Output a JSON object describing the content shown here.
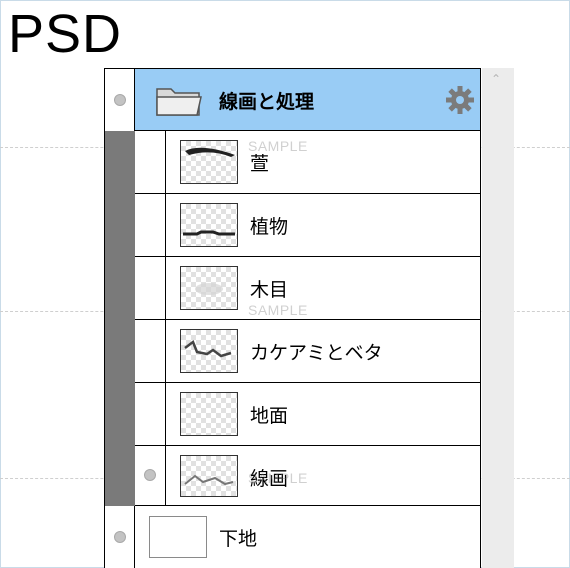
{
  "header": {
    "title": "PSD"
  },
  "watermark": "SAMPLE",
  "layers_panel": {
    "group": {
      "label": "線画と処理",
      "icon": "folder-icon",
      "settings_icon": "gear-icon",
      "visible_indicator": "eye-dot"
    },
    "children": [
      {
        "label": "萱"
      },
      {
        "label": "植物"
      },
      {
        "label": "木目"
      },
      {
        "label": "カケアミとベタ"
      },
      {
        "label": "地面"
      },
      {
        "label": "線画"
      }
    ],
    "base_layer": {
      "label": "下地"
    }
  },
  "colors": {
    "group_highlight": "#99ccf5",
    "indent_bar": "#7a7a7a",
    "scrollbar": "#ececec"
  }
}
